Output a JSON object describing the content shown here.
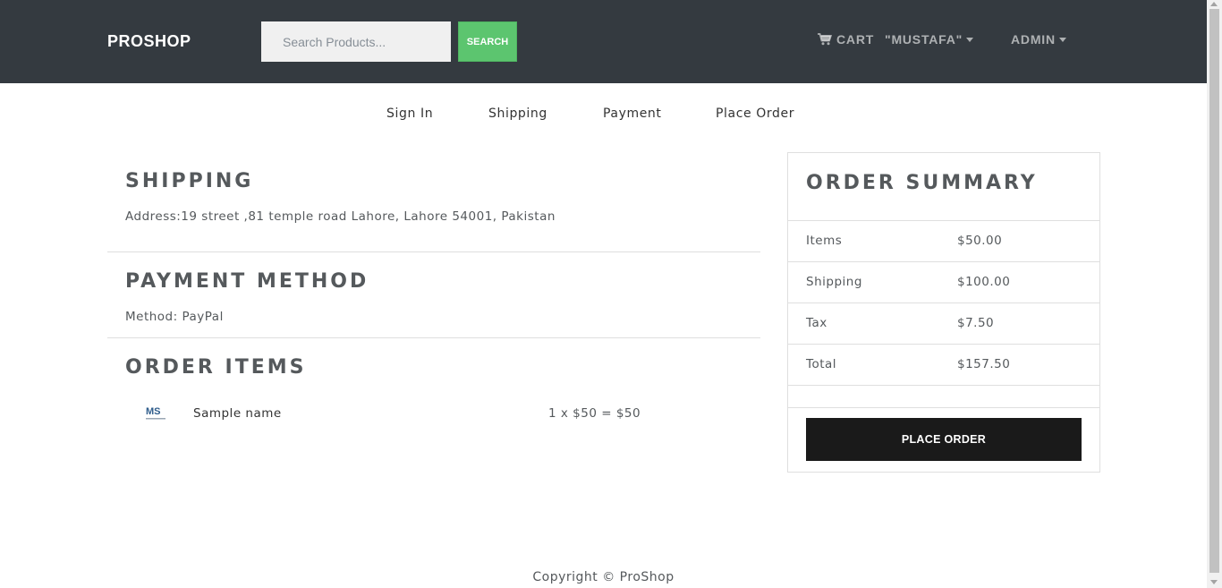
{
  "header": {
    "brand": "PROSHOP",
    "search_placeholder": "Search Products...",
    "search_button": "SEARCH",
    "cart_label": "CART",
    "user_label": "\"MUSTAFA\"",
    "admin_label": "ADMIN"
  },
  "steps": [
    "Sign In",
    "Shipping",
    "Payment",
    "Place Order"
  ],
  "shipping": {
    "title": "SHIPPING",
    "address": "Address:19 street ,81 temple road Lahore, Lahore 54001, Pakistan"
  },
  "payment": {
    "title": "PAYMENT METHOD",
    "method": "Method: PayPal"
  },
  "order_items": {
    "title": "ORDER ITEMS",
    "items": [
      {
        "name": "Sample name",
        "price_line": "1 x $50 = $50",
        "logo_text": "MS"
      }
    ]
  },
  "summary": {
    "title": "ORDER SUMMARY",
    "rows": [
      {
        "label": "Items",
        "value": "$50.00"
      },
      {
        "label": "Shipping",
        "value": "$100.00"
      },
      {
        "label": "Tax",
        "value": "$7.50"
      },
      {
        "label": "Total",
        "value": "$157.50"
      }
    ],
    "button": "PLACE ORDER"
  },
  "footer": {
    "text": "Copyright © ProShop"
  },
  "colors": {
    "navbar": "#343a40",
    "search_button": "#5cc56f",
    "place_order_button": "#1a1a1a"
  }
}
